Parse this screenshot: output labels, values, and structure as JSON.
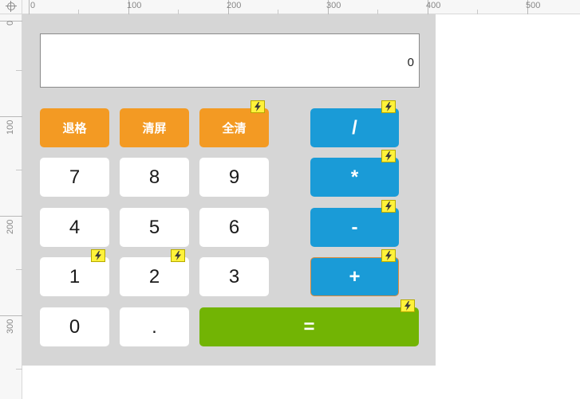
{
  "rulers": {
    "top_labels": [
      "0",
      "100",
      "200",
      "300",
      "400",
      "500"
    ],
    "left_labels": [
      "0",
      "100",
      "200",
      "300"
    ]
  },
  "display": {
    "value": "0"
  },
  "keys": {
    "backspace": "退格",
    "clear_entry": "清屏",
    "all_clear": "全清",
    "divide": "/",
    "multiply": "*",
    "subtract": "-",
    "add": "+",
    "equals": "=",
    "digit_7": "7",
    "digit_8": "8",
    "digit_9": "9",
    "digit_4": "4",
    "digit_5": "5",
    "digit_6": "6",
    "digit_1": "1",
    "digit_2": "2",
    "digit_3": "3",
    "digit_0": "0",
    "decimal": "."
  },
  "colors": {
    "function_key": "#f39a23",
    "operator_key": "#1a9bd7",
    "equals_key": "#72b404",
    "canvas": "#d6d6d6",
    "interaction_marker": "#fff23a"
  },
  "icons": {
    "interaction_marker": "lightning-bolt-icon"
  }
}
